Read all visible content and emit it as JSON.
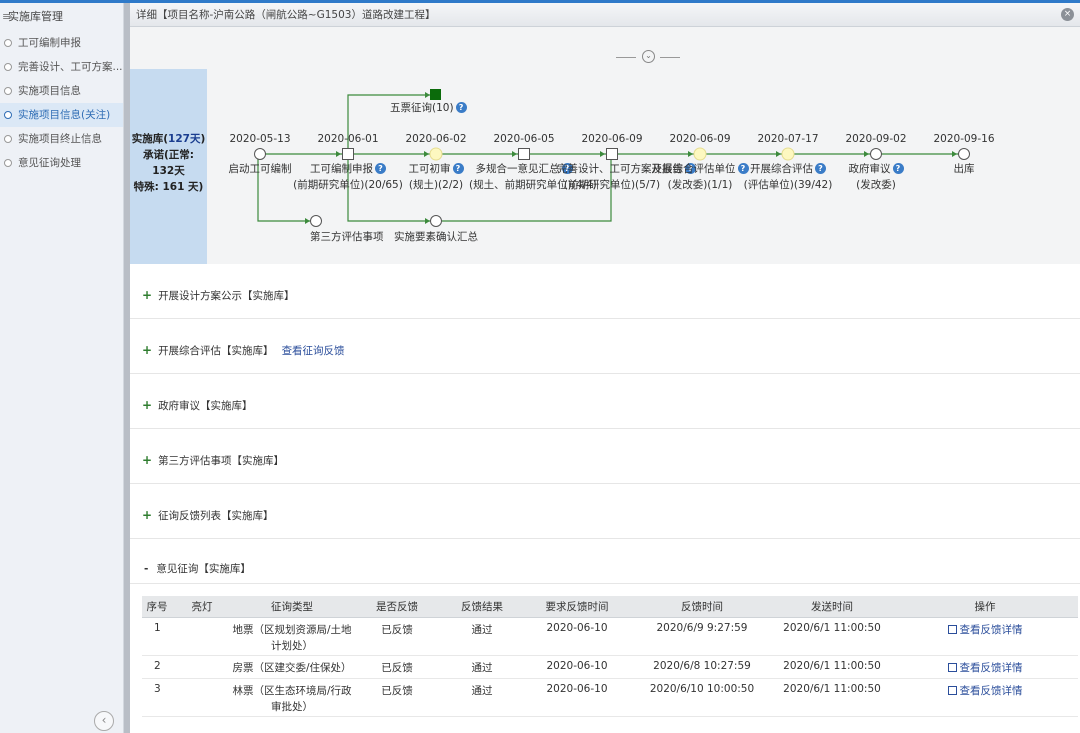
{
  "sidebar": {
    "title": "实施库管理",
    "items": [
      {
        "label": "工可编制申报"
      },
      {
        "label": "完善设计、工可方案..."
      },
      {
        "label": "实施项目信息"
      },
      {
        "label": "实施项目信息(关注)"
      },
      {
        "label": "实施项目终止信息"
      },
      {
        "label": "意见征询处理"
      }
    ],
    "active_index": 3
  },
  "header": {
    "title": "详细【项目名称-沪南公路（闸航公路~G1503）道路改建工程】"
  },
  "summary": {
    "line1_prefix": "实施库(",
    "line1_value": "127天",
    "line1_suffix": ")",
    "line2": "承诺(正常:",
    "line3": "132天",
    "line4": "特殊: 161 天)"
  },
  "timeline": {
    "nodes": [
      {
        "date": "2020-05-13",
        "label1": "启动工可编制",
        "label2": "",
        "shape": "circle",
        "help": false
      },
      {
        "date": "2020-06-01",
        "label1": "工可编制申报",
        "label2": "(前期研究单位)(20/65)",
        "shape": "square",
        "help": true
      },
      {
        "date": "2020-06-02",
        "label1": "工可初审",
        "label2": "(规土)(2/2)",
        "shape": "circle-yellow",
        "help": true
      },
      {
        "date": "2020-06-05",
        "label1": "多规合一意见汇总",
        "label2": "(规土、前期研究单位)(4/4)",
        "shape": "square",
        "help": true
      },
      {
        "date": "2020-06-09",
        "label1": "完善设计、工可方案及报告",
        "label2": "(前期研究单位)(5/7)",
        "shape": "square",
        "help": true
      },
      {
        "date": "2020-06-09",
        "label1": "开展综合评估单位",
        "label2": "(发改委)(1/1)",
        "shape": "circle-yellow",
        "help": true
      },
      {
        "date": "2020-07-17",
        "label1": "开展综合评估",
        "label2": "(评估单位)(39/42)",
        "shape": "circle-yellow",
        "help": true
      },
      {
        "date": "2020-09-02",
        "label1": "政府审议",
        "label2": "(发改委)",
        "shape": "circle",
        "help": true
      },
      {
        "date": "2020-09-16",
        "label1": "出库",
        "label2": "",
        "shape": "circle",
        "help": false
      }
    ],
    "branch_top": {
      "label": "五票征询(10)",
      "help": true
    },
    "branch_bottom_1": {
      "label": "第三方评估事项"
    },
    "branch_bottom_2": {
      "label": "实施要素确认汇总"
    },
    "colors": {
      "line": "#3c8a3c",
      "done": "#0b6b0b",
      "pending": "#fdf8c0"
    }
  },
  "sections": [
    {
      "label": "开展设计方案公示【实施库】",
      "link": ""
    },
    {
      "label": "开展综合评估【实施库】",
      "link": "查看征询反馈"
    },
    {
      "label": "政府审议【实施库】",
      "link": ""
    },
    {
      "label": "第三方评估事项【实施库】",
      "link": ""
    },
    {
      "label": "征询反馈列表【实施库】",
      "link": ""
    }
  ],
  "opinion": {
    "label": "意见征询【实施库】",
    "columns": [
      "序号",
      "亮灯",
      "征询类型",
      "是否反馈",
      "反馈结果",
      "要求反馈时间",
      "反馈时间",
      "发送时间",
      "操作"
    ],
    "rows": [
      {
        "no": "1",
        "light": "",
        "type1": "地票（区规划资源局/土地",
        "type2": "计划处）",
        "feedback": "已反馈",
        "result": "通过",
        "due": "2020-06-10",
        "fb_time": "2020/6/9 9:27:59",
        "send": "2020/6/1 11:00:50",
        "op": "查看反馈详情"
      },
      {
        "no": "2",
        "light": "",
        "type1": "房票（区建交委/住保处）",
        "type2": "",
        "feedback": "已反馈",
        "result": "通过",
        "due": "2020-06-10",
        "fb_time": "2020/6/8 10:27:59",
        "send": "2020/6/1 11:00:50",
        "op": "查看反馈详情"
      },
      {
        "no": "3",
        "light": "",
        "type1": "林票（区生态环境局/行政",
        "type2": "审批处）",
        "feedback": "已反馈",
        "result": "通过",
        "due": "2020-06-10",
        "fb_time": "2020/6/10 10:00:50",
        "send": "2020/6/1 11:00:50",
        "op": "查看反馈详情"
      }
    ]
  }
}
